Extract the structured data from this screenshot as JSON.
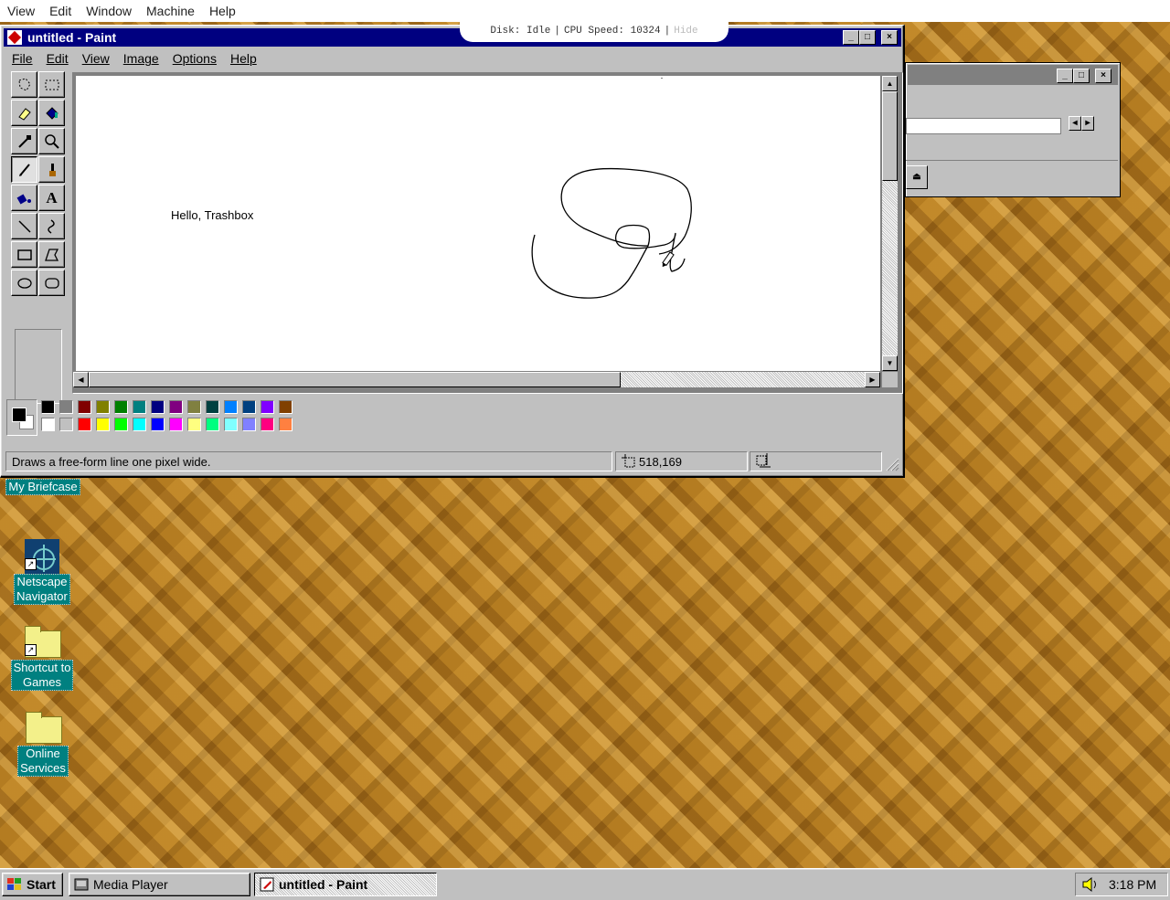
{
  "host_menu": [
    "View",
    "Edit",
    "Window",
    "Machine",
    "Help"
  ],
  "host_status": {
    "disk": "Disk: Idle",
    "separator": "|",
    "cpu": "CPU Speed: 10324",
    "hide": "Hide"
  },
  "paint": {
    "title": "untitled - Paint",
    "menu": [
      "File",
      "Edit",
      "View",
      "Image",
      "Options",
      "Help"
    ],
    "canvas_text": "Hello, Trashbox",
    "status_text": "Draws a free-form line one pixel wide.",
    "coords": "518,169",
    "size": "",
    "active_tool": "pencil",
    "palette_top": [
      "#000000",
      "#808080",
      "#800000",
      "#808000",
      "#008000",
      "#008080",
      "#000080",
      "#800080",
      "#808040",
      "#004040",
      "#0080ff",
      "#004080",
      "#8000ff",
      "#804000"
    ],
    "palette_bottom": [
      "#ffffff",
      "#c0c0c0",
      "#ff0000",
      "#ffff00",
      "#00ff00",
      "#00ffff",
      "#0000ff",
      "#ff00ff",
      "#ffff80",
      "#00ff80",
      "#80ffff",
      "#8080ff",
      "#ff0080",
      "#ff8040"
    ],
    "foreground_color": "#000000",
    "background_color": "#ffffff"
  },
  "desktop_icons": [
    {
      "label": "My Briefcase"
    },
    {
      "label_lines": [
        "Netscape",
        "Navigator"
      ]
    },
    {
      "label_lines": [
        "Shortcut to",
        "Games"
      ]
    },
    {
      "label_lines": [
        "Online",
        "Services"
      ]
    }
  ],
  "taskbar": {
    "start": "Start",
    "tasks": [
      "Media Player",
      "untitled - Paint"
    ],
    "clock": "3:18 PM"
  }
}
